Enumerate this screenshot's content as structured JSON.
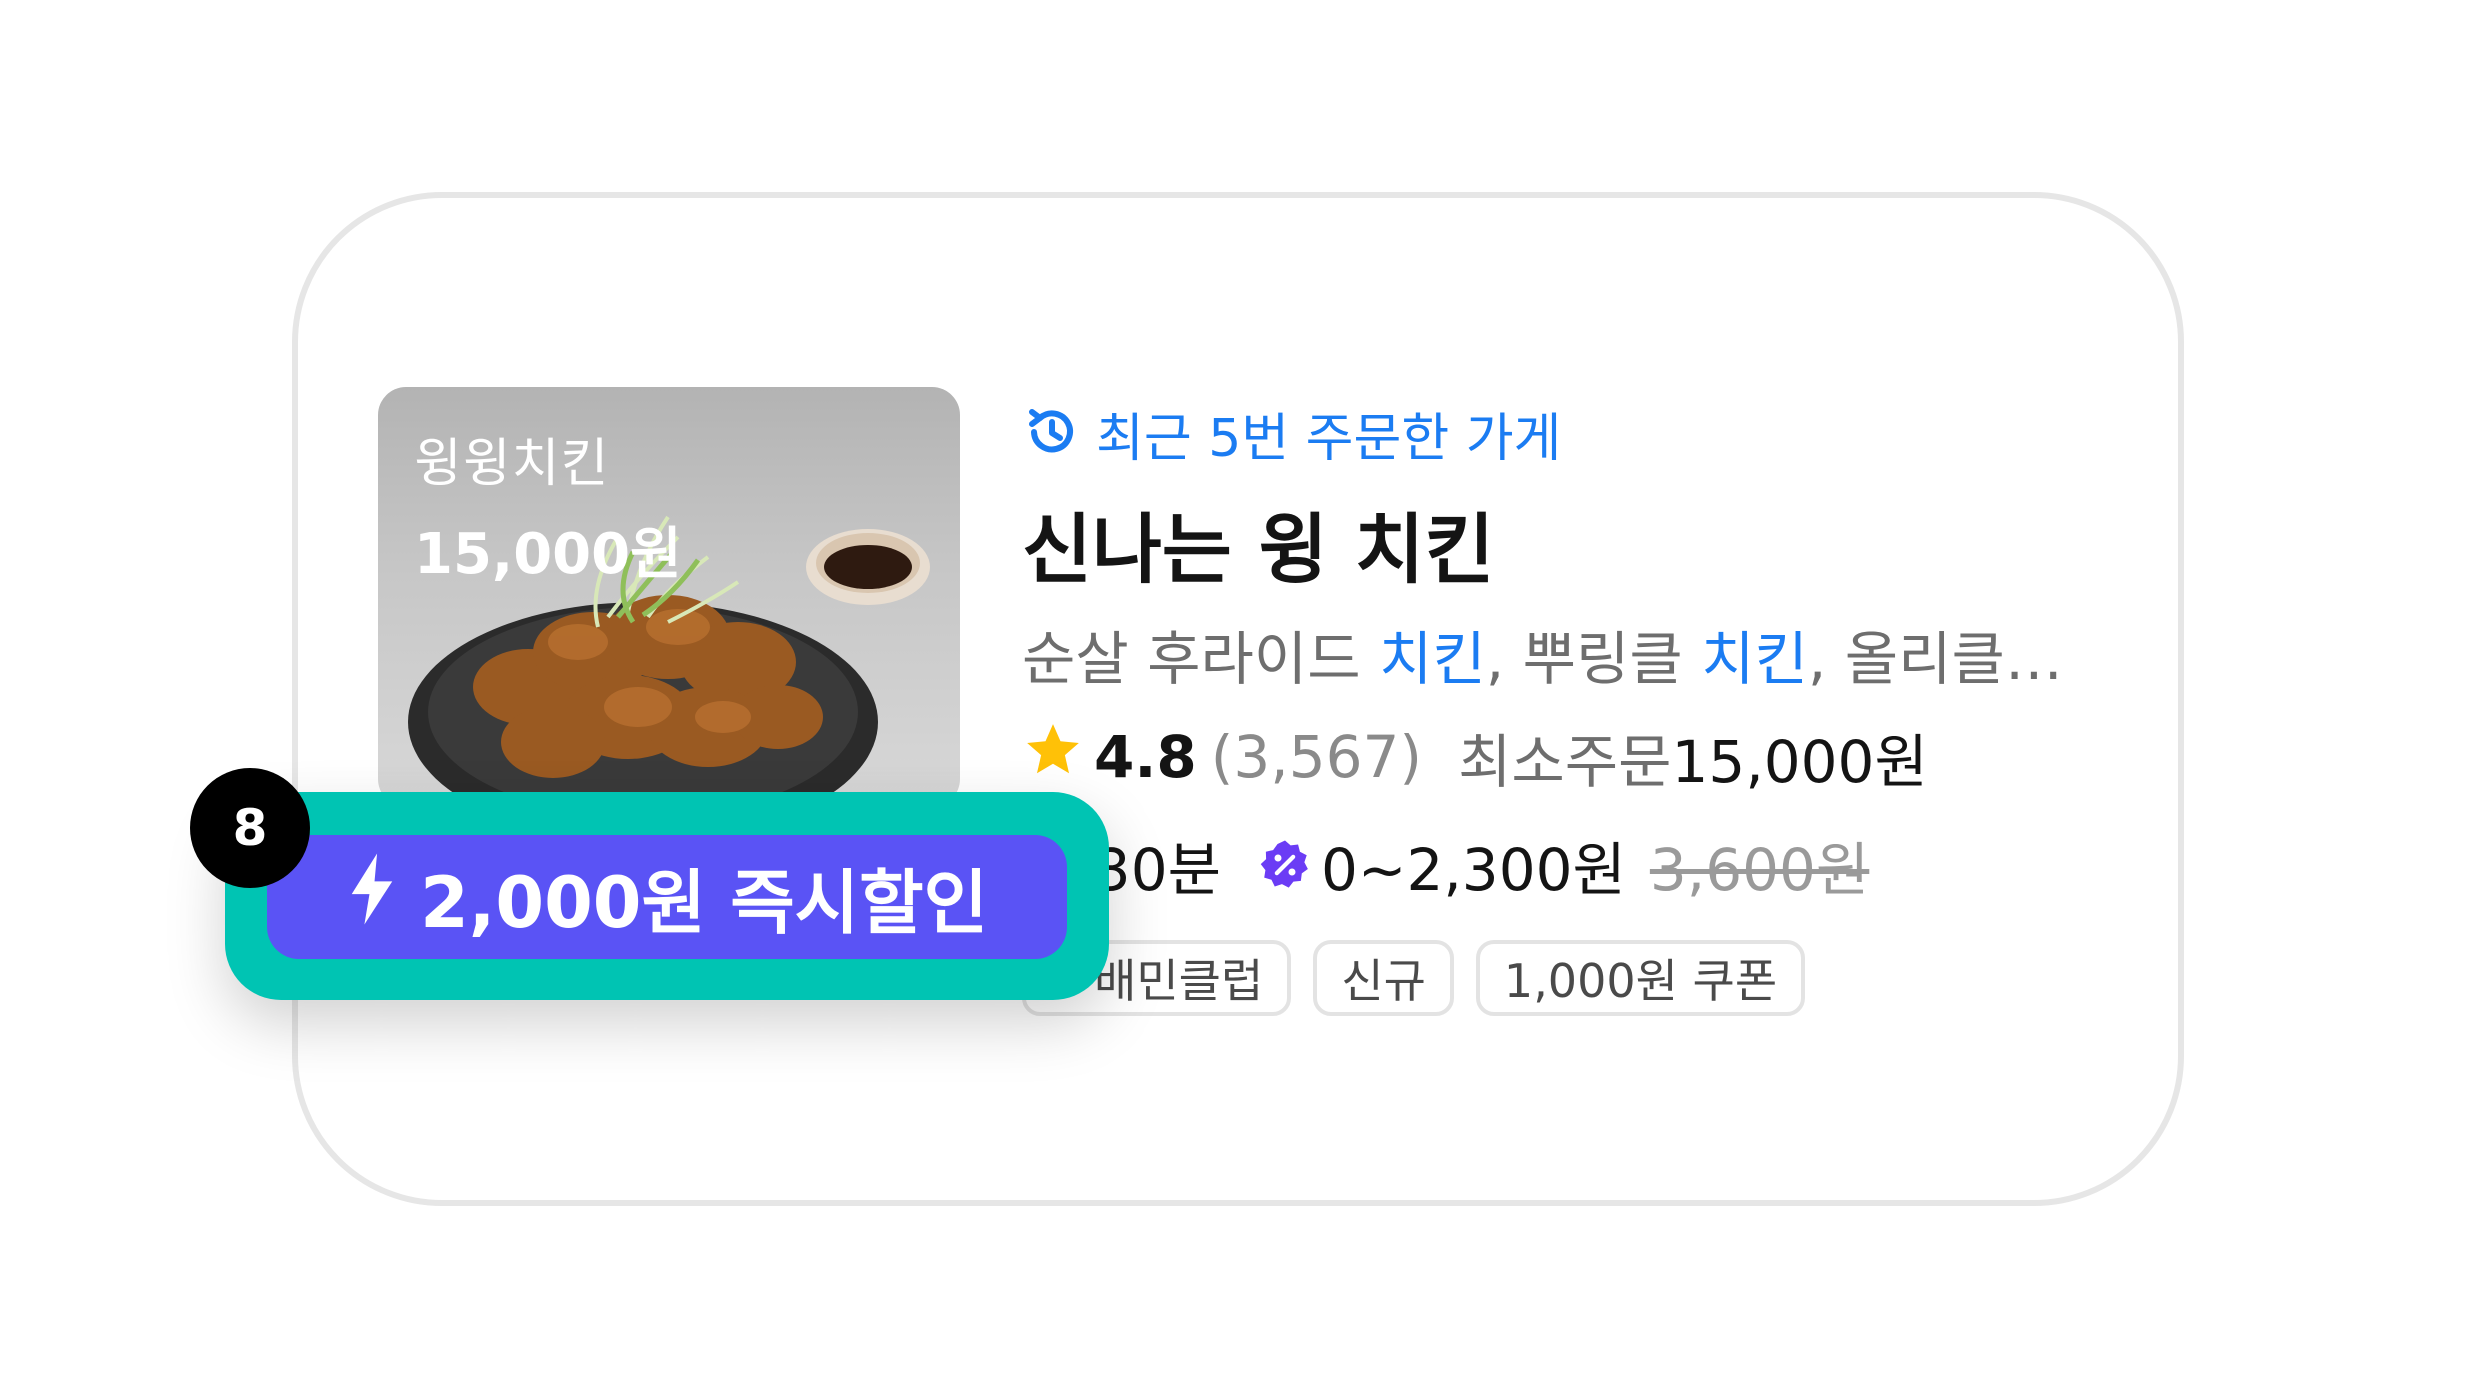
{
  "store": {
    "thumbnail": {
      "name": "윙윙치킨",
      "price": "15,000원"
    },
    "recent_label": "최근 5번 주문한 가게",
    "name": "신나는 윙 치킨",
    "menu": {
      "part1": "순살 후라이드 ",
      "hl1": "치킨",
      "part2": ", 뿌링클 ",
      "hl2": "치킨",
      "part3": ", 올리클…"
    },
    "rating": "4.8",
    "review_count": "(3,567)",
    "min_order_label": "최소주문",
    "min_order_value": "15,000원",
    "delivery_time": "약 30분",
    "delivery_fee": "0~2,300원",
    "original_fee": "3,600원",
    "tags": [
      "배민클럽",
      "신규",
      "1,000원 쿠폰"
    ]
  },
  "discount": {
    "label": "2,000원 즉시할인"
  },
  "step_badge": "8",
  "colors": {
    "accent_blue": "#1b7cf2",
    "discount_purple": "#5a53f5",
    "highlight_teal": "#00c4b3",
    "star_yellow": "#ffc107",
    "club_purple": "#6b3cf5"
  },
  "icons": [
    "recent-order-clock-icon",
    "star-icon",
    "discount-percent-icon",
    "lightning-icon",
    "club-icon"
  ]
}
